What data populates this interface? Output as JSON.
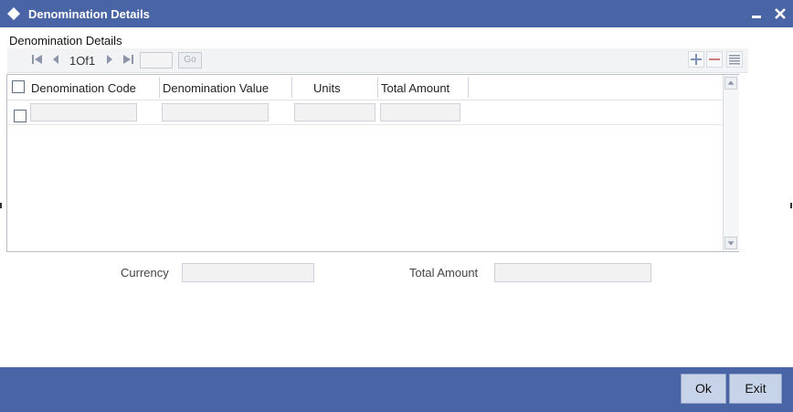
{
  "window": {
    "title": "Denomination Details"
  },
  "section": {
    "title": "Denomination Details"
  },
  "pagination": {
    "current": "1",
    "separator": "Of",
    "total": "1",
    "go_label": "Go"
  },
  "grid": {
    "columns": [
      "Denomination Code",
      "Denomination Value",
      "Units",
      "Total Amount"
    ],
    "rows": [
      {
        "code": "",
        "value": "",
        "units": "",
        "total": ""
      }
    ]
  },
  "summary": {
    "currency_label": "Currency",
    "currency_value": "",
    "total_amount_label": "Total Amount",
    "total_amount_value": ""
  },
  "footer": {
    "ok_label": "Ok",
    "exit_label": "Exit"
  },
  "colors": {
    "titlebar": "#4a65a5",
    "footer": "#4a65a5",
    "button_bg": "#c7d3e8"
  },
  "icons": [
    "diamond-icon",
    "minimize-icon",
    "close-icon",
    "first-page-icon",
    "prev-page-icon",
    "next-page-icon",
    "last-page-icon",
    "add-row-icon",
    "delete-row-icon",
    "single-view-icon"
  ]
}
